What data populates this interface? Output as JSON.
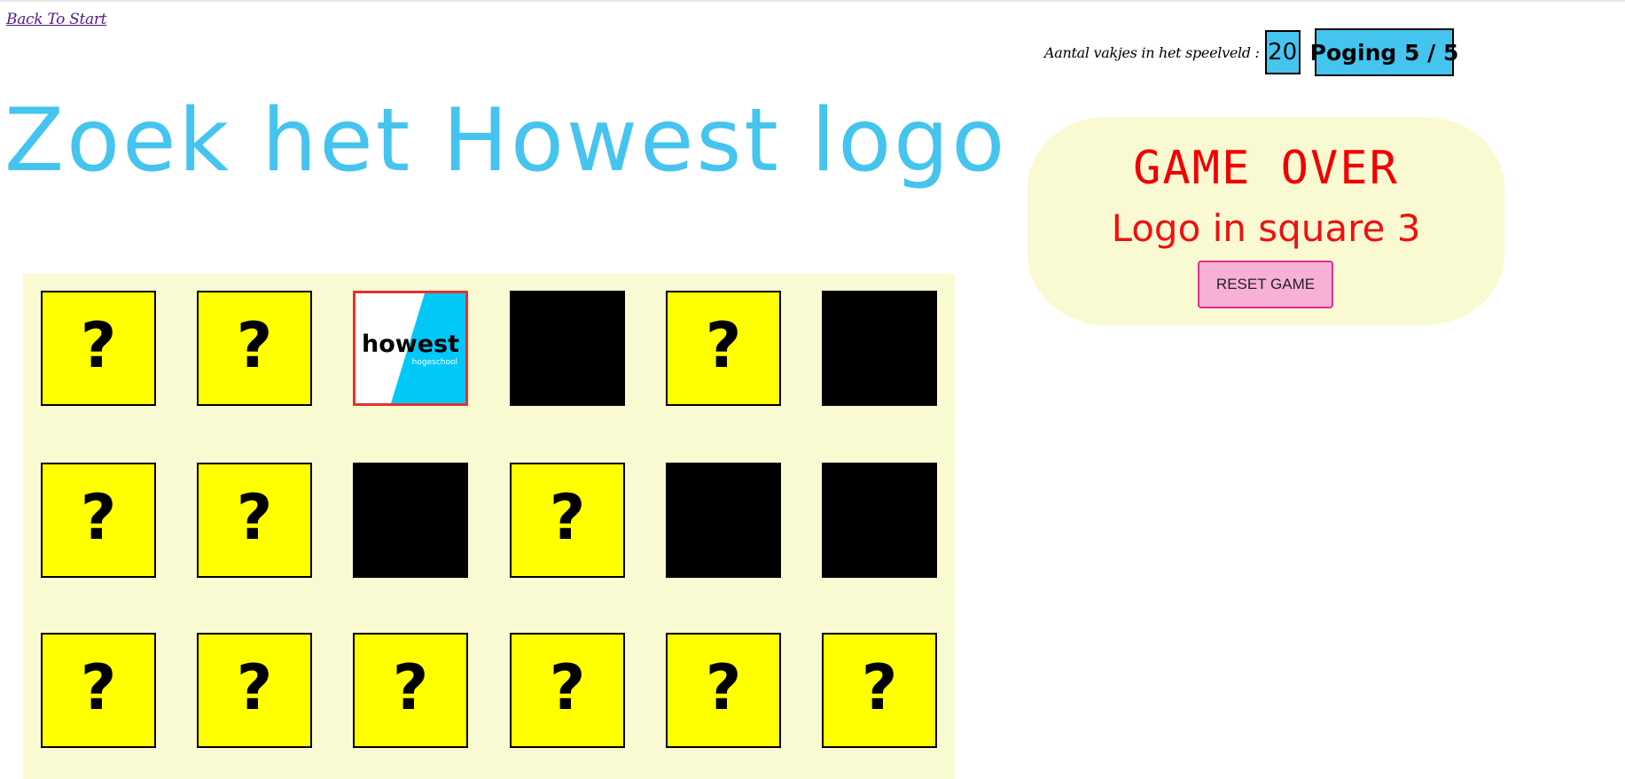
{
  "nav": {
    "back_label": "Back To Start"
  },
  "title": "Zoek het Howest logo",
  "counter": {
    "label": "Aantal vakjes in het speelveld :",
    "value": "20"
  },
  "attempt": {
    "text": "Poging 5 / 5"
  },
  "gameover": {
    "title": "GAME OVER",
    "message": "Logo in square 3",
    "reset_label": "RESET GAME"
  },
  "logo": {
    "word": "howest",
    "sub": "hogeschool",
    "accent_color": "#00c8f8"
  },
  "colors": {
    "title": "#45c4ef",
    "hidden_cell": "#ffff00",
    "board_bg": "#fafad2",
    "gameover_text": "#f00000",
    "reset_bg": "#f7b0d6"
  },
  "board": {
    "columns": 6,
    "cells": [
      {
        "state": "hidden",
        "label": "?"
      },
      {
        "state": "hidden",
        "label": "?"
      },
      {
        "state": "logo",
        "label": ""
      },
      {
        "state": "empty",
        "label": ""
      },
      {
        "state": "hidden",
        "label": "?"
      },
      {
        "state": "empty",
        "label": ""
      },
      {
        "state": "hidden",
        "label": "?"
      },
      {
        "state": "hidden",
        "label": "?"
      },
      {
        "state": "empty",
        "label": ""
      },
      {
        "state": "hidden",
        "label": "?"
      },
      {
        "state": "empty",
        "label": ""
      },
      {
        "state": "empty",
        "label": ""
      },
      {
        "state": "hidden",
        "label": "?"
      },
      {
        "state": "hidden",
        "label": "?"
      },
      {
        "state": "hidden",
        "label": "?"
      },
      {
        "state": "hidden",
        "label": "?"
      },
      {
        "state": "hidden",
        "label": "?"
      },
      {
        "state": "hidden",
        "label": "?"
      }
    ]
  }
}
